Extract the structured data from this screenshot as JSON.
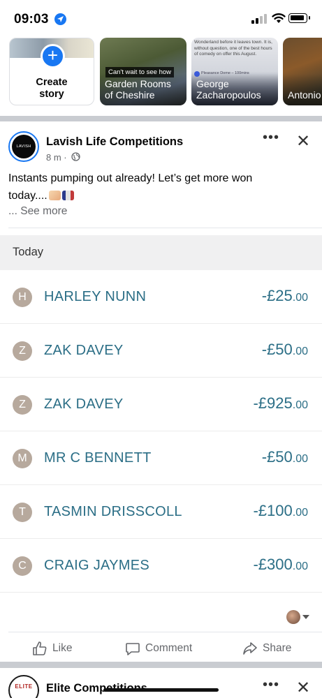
{
  "status_bar": {
    "time": "09:03"
  },
  "stories": {
    "create": {
      "label_line1": "Create",
      "label_line2": "story"
    },
    "items": [
      {
        "tag": "Can't wait to see how",
        "name_line1": "Garden Rooms",
        "name_line2": "of Cheshire"
      },
      {
        "blurb": "Wonderland before it leaves town. It is, without question, one of the best hours of comedy on offer this August.",
        "pin": "Pleasance Dome – 100mins",
        "name_line1": "George",
        "name_line2": "Zacharopoulos"
      },
      {
        "name_line1": "Antonio",
        "name_line2": ""
      }
    ]
  },
  "post": {
    "author": "Lavish Life Competitions",
    "avatar_text": "LAVISH LIFE",
    "meta": "8 m ·",
    "text_line1": "Instants pumping out already! Let’s get more won",
    "text_line2": "today....",
    "see_more": "... See more"
  },
  "transactions": {
    "section_label": "Today",
    "rows": [
      {
        "initial": "H",
        "name": "HARLEY NUNN",
        "amount": "-£25",
        "decimals": ".00"
      },
      {
        "initial": "Z",
        "name": "ZAK DAVEY",
        "amount": "-£50",
        "decimals": ".00"
      },
      {
        "initial": "Z",
        "name": "ZAK DAVEY",
        "amount": "-£925",
        "decimals": ".00"
      },
      {
        "initial": "M",
        "name": "MR C BENNETT",
        "amount": "-£50",
        "decimals": ".00"
      },
      {
        "initial": "T",
        "name": "TASMIN DRISSCOLL",
        "amount": "-£100",
        "decimals": ".00"
      },
      {
        "initial": "C",
        "name": "CRAIG JAYMES",
        "amount": "-£300",
        "decimals": ".00"
      }
    ]
  },
  "actions": {
    "like": "Like",
    "comment": "Comment",
    "share": "Share"
  },
  "next_post": {
    "author": "Elite Competitions",
    "avatar_text": "ELITE"
  },
  "colors": {
    "accent": "#1877f2",
    "transaction_text": "#2b6e86",
    "initial_circle": "#b7a99d"
  }
}
